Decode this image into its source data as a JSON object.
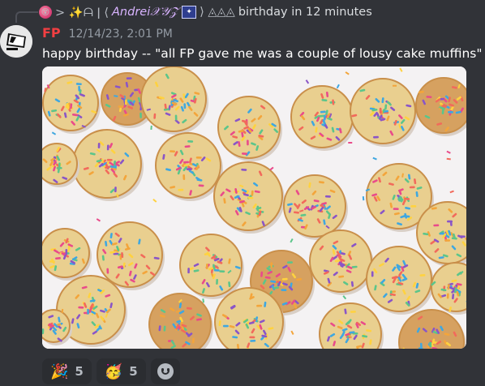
{
  "reply": {
    "prefix_icons": "> ✨ᗩ ǀ ⟨",
    "author": "𝘈𝘯𝘥𝘳𝘦𝘪𝒳𝒴𝒵",
    "suffix_icons": "⟩ ◬◬◬",
    "text": "birthday in 12 minutes"
  },
  "message": {
    "author": "FP",
    "timestamp": "12/14/23, 2:01 PM",
    "content": "happy birthday -- \"all FP gave me was a couple of lousy cake muffins\"",
    "attachment_icon": "cake-muffins-photo"
  },
  "reactions": [
    {
      "emoji": "🎉",
      "icon": "party-popper-icon",
      "count": "5"
    },
    {
      "emoji": "🥳",
      "icon": "party-face-icon",
      "count": "5"
    }
  ],
  "colors": {
    "username": "#f23f42",
    "background": "#313338"
  }
}
